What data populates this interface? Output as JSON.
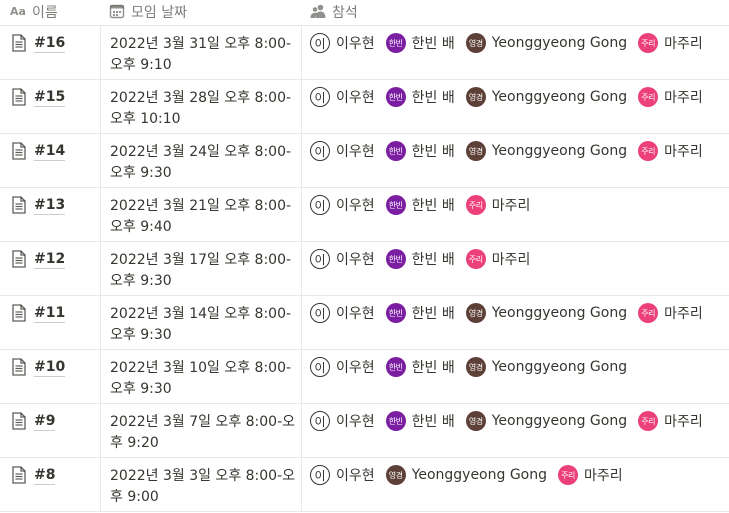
{
  "columns": {
    "name": {
      "label": "이름",
      "icon": "text-aa-icon"
    },
    "date": {
      "label": "모임 날짜",
      "icon": "calendar-icon"
    },
    "attendance": {
      "label": "참석",
      "icon": "people-icon"
    }
  },
  "colors": {
    "text": "#37352F",
    "border": "#E9E9E7",
    "avatar_hanbin": "#7B1FA2",
    "avatar_yeonggyeong": "#5D4037",
    "avatar_juri": "#EC407A"
  },
  "people": {
    "lee": {
      "name": "이우현",
      "avatar_text": "이",
      "style": "outline"
    },
    "han": {
      "name": "한빈 배",
      "avatar_text": "한빈",
      "color": "#7B1FA2"
    },
    "gong": {
      "name": "Yeonggyeong Gong",
      "avatar_text": "영경",
      "color": "#5D4037"
    },
    "ma": {
      "name": "마주리",
      "avatar_text": "주리",
      "color": "#EC407A"
    }
  },
  "rows": [
    {
      "title": "#16",
      "date": "2022년 3월 31일 오후 8:00-오후 9:10",
      "attendees": [
        "lee",
        "han",
        "gong",
        "ma"
      ]
    },
    {
      "title": "#15",
      "date": "2022년 3월 28일 오후 8:00-오후 10:10",
      "attendees": [
        "lee",
        "han",
        "gong",
        "ma"
      ]
    },
    {
      "title": "#14",
      "date": "2022년 3월 24일 오후 8:00-오후 9:30",
      "attendees": [
        "lee",
        "han",
        "gong",
        "ma"
      ]
    },
    {
      "title": "#13",
      "date": "2022년 3월 21일 오후 8:00-오후 9:40",
      "attendees": [
        "lee",
        "han",
        "ma"
      ]
    },
    {
      "title": "#12",
      "date": "2022년 3월 17일 오후 8:00-오후 9:30",
      "attendees": [
        "lee",
        "han",
        "ma"
      ]
    },
    {
      "title": "#11",
      "date": "2022년 3월 14일 오후 8:00-오후 9:30",
      "attendees": [
        "lee",
        "han",
        "gong",
        "ma"
      ]
    },
    {
      "title": "#10",
      "date": "2022년 3월 10일 오후 8:00-오후 9:30",
      "attendees": [
        "lee",
        "han",
        "gong"
      ]
    },
    {
      "title": "#9",
      "date": "2022년 3월 7일 오후 8:00-오후 9:20",
      "attendees": [
        "lee",
        "han",
        "gong",
        "ma"
      ]
    },
    {
      "title": "#8",
      "date": "2022년 3월 3일 오후 8:00-오후 9:00",
      "attendees": [
        "lee",
        "gong",
        "ma"
      ]
    }
  ]
}
